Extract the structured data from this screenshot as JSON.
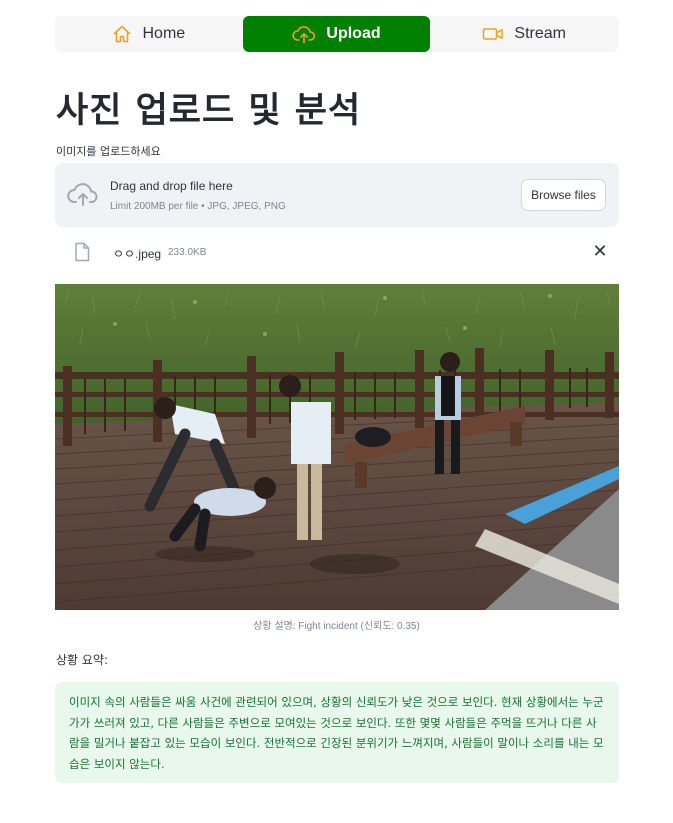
{
  "nav": {
    "items": [
      {
        "label": "Home",
        "icon": "home-icon"
      },
      {
        "label": "Upload",
        "icon": "cloud-upload-icon",
        "active": true
      },
      {
        "label": "Stream",
        "icon": "video-camera-icon"
      }
    ],
    "active_color": "#008000",
    "icon_color": "#f0a020"
  },
  "page": {
    "title": "사진 업로드 및 분석"
  },
  "uploader": {
    "label": "이미지를 업로드하세요",
    "drop_text": "Drag and drop file here",
    "limit_text": "Limit 200MB per file • JPG, JPEG, PNG",
    "browse_label": "Browse files",
    "icon": "cloud-upload-icon"
  },
  "file": {
    "name": "ㅇㅇ.jpeg",
    "size": "233.0KB",
    "icon": "file-icon",
    "remove_icon": "close-icon",
    "remove_glyph": "✕"
  },
  "image": {
    "caption": "상황 설명: Fight incident (신뢰도: 0.35)"
  },
  "summary": {
    "label": "상황 요약:",
    "text": "이미지 속의 사람들은 싸움 사건에 관련되어 있으며, 상황의 신뢰도가 낮은 것으로 보인다. 현재 상황에서는 누군가가 쓰러져 있고, 다른 사람들은 주변으로 모여있는 것으로 보인다. 또한 몇몇 사람들은 주먹을 뜨거나 다른 사람을 밀거나 붙잡고 있는 모습이 보인다. 전반적으로 긴장된 분위기가 느껴지며, 사람들이 말이나 소리를 내는 모습은 보이지 않는다.",
    "bg_color": "#e8f8ec",
    "text_color": "#177233"
  }
}
